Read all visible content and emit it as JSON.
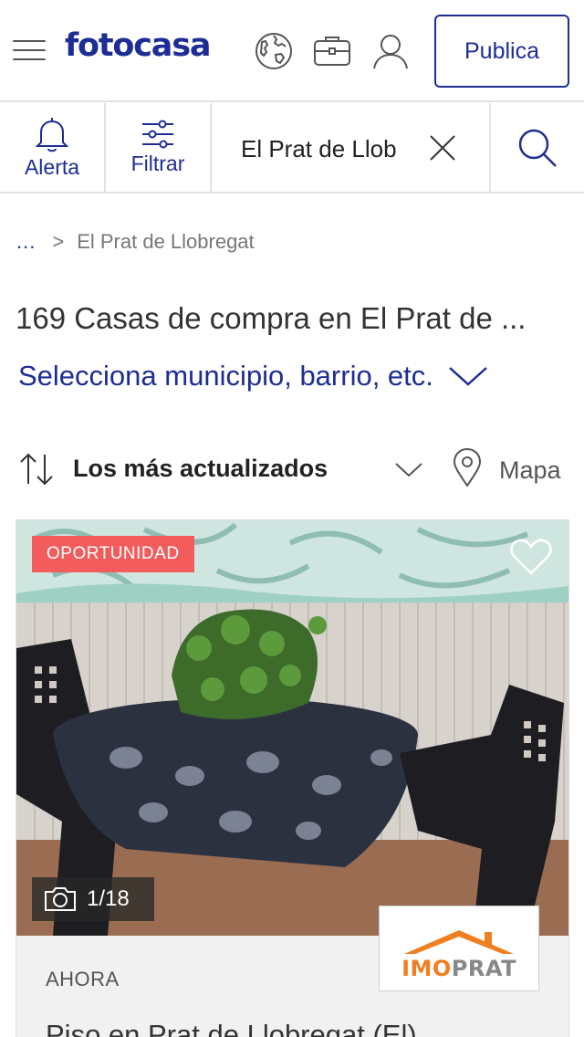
{
  "header": {
    "logo": "fotocasa",
    "publish_label": "Publica",
    "icons": [
      "menu-icon",
      "globe-icon",
      "briefcase-icon",
      "user-icon"
    ]
  },
  "searchbar": {
    "alert_label": "Alerta",
    "filter_label": "Filtrar",
    "search_value": "El Prat de Llob"
  },
  "breadcrumb": {
    "more": "...",
    "separator": ">",
    "current": "El Prat de Llobregat"
  },
  "results": {
    "title": "169 Casas de compra en El Prat de ...",
    "location_select": "Selecciona municipio, barrio, etc."
  },
  "sort": {
    "label": "Los más actualizados",
    "map_label": "Mapa"
  },
  "listing": {
    "badge": "OPORTUNIDAD",
    "photo_counter": "1/18",
    "agency_imo": "IMO",
    "agency_prat": "PRAT",
    "time": "AHORA",
    "title": "Piso en Prat de Llobregat (El)"
  },
  "colors": {
    "brand": "#1d2d95",
    "badge": "#f25c5c",
    "agency_orange": "#f07f21"
  }
}
